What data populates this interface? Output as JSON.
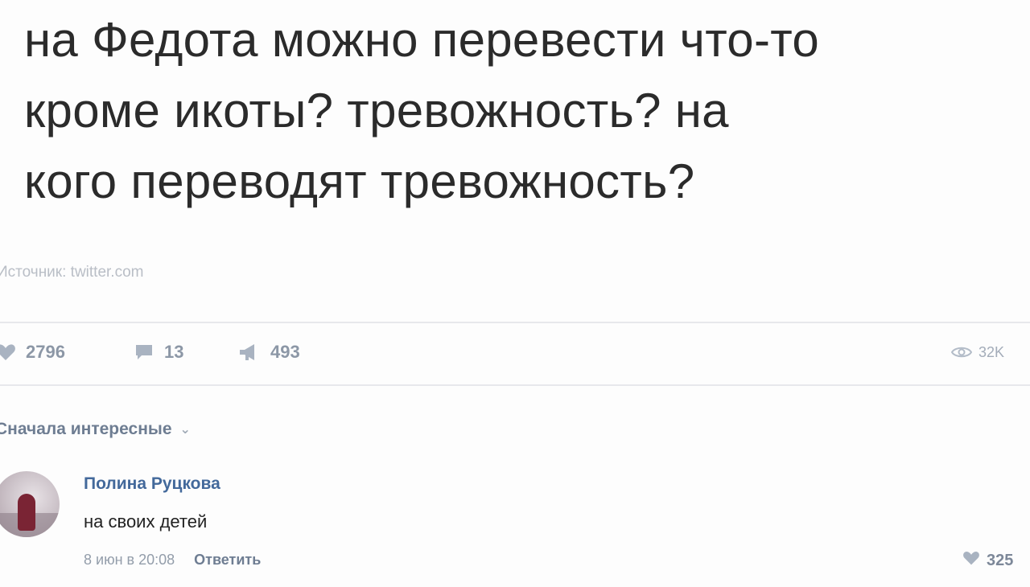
{
  "post": {
    "lines": [
      "на Федота можно перевести что-то",
      "кроме икоты? тревожность? на",
      "кого переводят тревожность?"
    ],
    "source": "Источник: twitter.com"
  },
  "actions": {
    "likes": "2796",
    "comments": "13",
    "reposts": "493",
    "views": "32K"
  },
  "comments_sort": {
    "label": "Сначала интересные",
    "chevron": "⌄"
  },
  "comment": {
    "author": "Полина Руцкова",
    "text": "на своих детей",
    "date": "8 июн в 20:08",
    "reply_label": "Ответить",
    "likes": "325"
  },
  "icons": {
    "like": "heart-icon",
    "comment": "comment-icon",
    "share": "megaphone-icon",
    "views": "eye-icon"
  },
  "colors": {
    "text": "#2b2b2b",
    "link": "#43699b",
    "muted": "#8c97a6",
    "divider": "#e7e8ec"
  }
}
